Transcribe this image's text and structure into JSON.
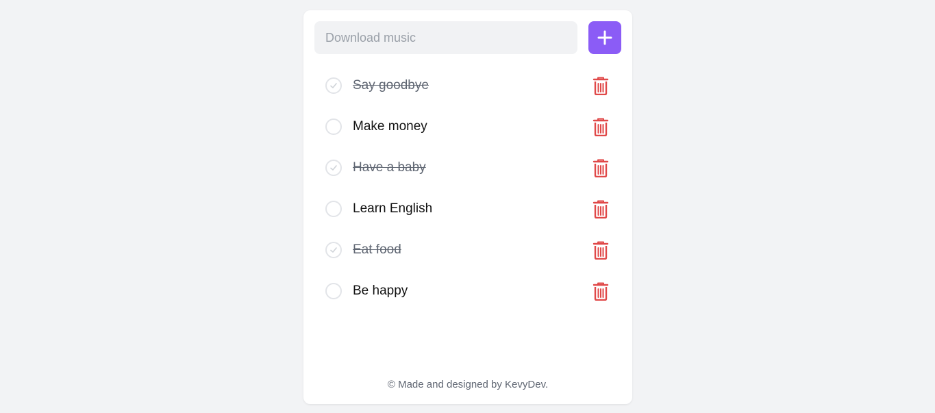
{
  "input": {
    "placeholder": "Download music",
    "value": ""
  },
  "add_button": {
    "icon": "plus-icon"
  },
  "tasks": [
    {
      "text": "Say goodbye",
      "done": true
    },
    {
      "text": "Make money",
      "done": false
    },
    {
      "text": "Have a baby",
      "done": true
    },
    {
      "text": "Learn English",
      "done": false
    },
    {
      "text": "Eat food",
      "done": true
    },
    {
      "text": "Be happy",
      "done": false
    }
  ],
  "footer": {
    "text": "© Made and designed by KevyDev."
  },
  "colors": {
    "accent": "#8b5cf6",
    "delete": "#e04848",
    "background": "#f2f3f5"
  }
}
